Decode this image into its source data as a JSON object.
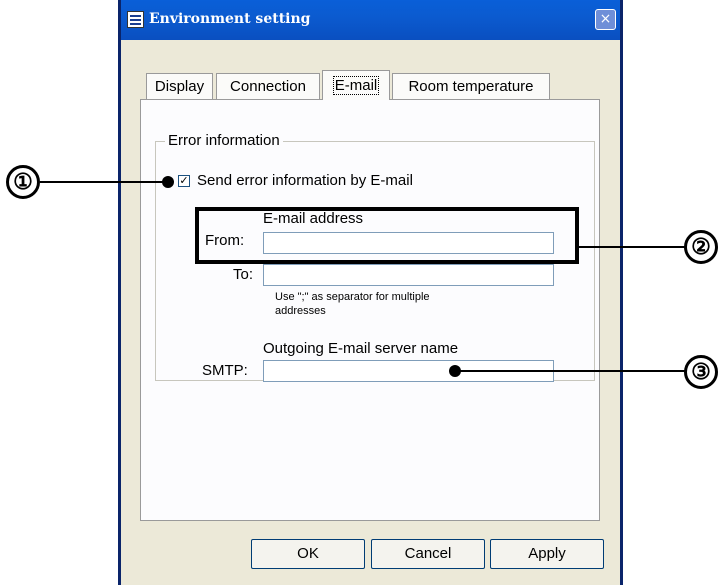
{
  "window": {
    "title": "Environment setting",
    "close_symbol": "×"
  },
  "tabs": [
    {
      "label": "Display",
      "active": false
    },
    {
      "label": "Connection",
      "active": false
    },
    {
      "label": "E-mail",
      "active": true
    },
    {
      "label": "Room temperature",
      "active": false
    }
  ],
  "error_info": {
    "group_title": "Error information",
    "checkbox_label": "Send error information by E-mail",
    "checked": true,
    "check_mark": "✓"
  },
  "email": {
    "section_label": "E-mail address",
    "from_label": "From:",
    "from_value": "",
    "to_label": "To:",
    "to_value": "",
    "note_line1": "Use \";\" as separator for multiple",
    "note_line2": "addresses"
  },
  "smtp": {
    "section_label": "Outgoing E-mail server name",
    "label": "SMTP:",
    "value": ""
  },
  "buttons": {
    "ok": "OK",
    "cancel": "Cancel",
    "apply": "Apply"
  },
  "callouts": {
    "one": "①",
    "two": "②",
    "three": "③"
  },
  "icons": {
    "app": "window-icon",
    "close": "close-icon"
  }
}
